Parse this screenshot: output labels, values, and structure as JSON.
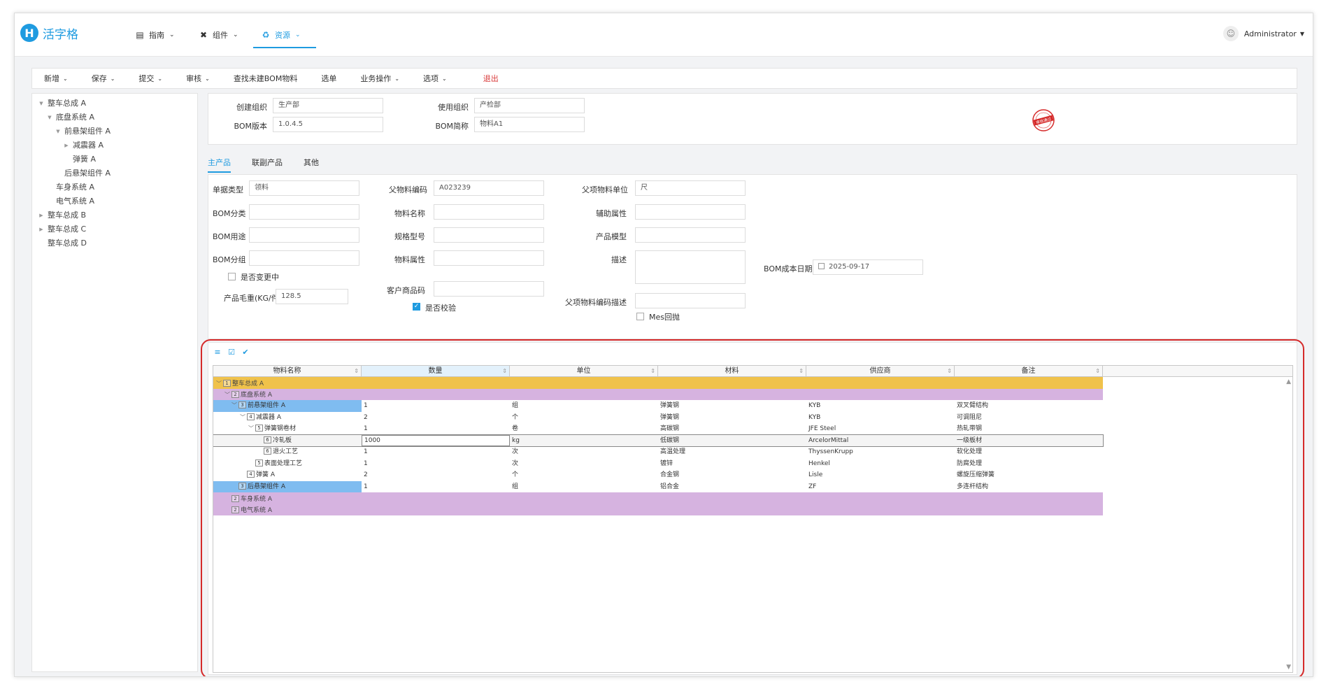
{
  "app": {
    "logo_letter": "H",
    "name": "活字格"
  },
  "nav": {
    "items": [
      {
        "label": "指南",
        "icon": "document-icon"
      },
      {
        "label": "组件",
        "icon": "tools-icon"
      },
      {
        "label": "资源",
        "icon": "recycle-icon"
      }
    ],
    "user": "Administrator"
  },
  "toolbar": {
    "items": [
      "新增",
      "保存",
      "提交",
      "审核",
      "查找未建BOM物料",
      "选单",
      "业务操作",
      "选项",
      "退出"
    ]
  },
  "tree": {
    "nodes": [
      {
        "label": "整车总成 A",
        "level": 0,
        "toggle": "▼"
      },
      {
        "label": "底盘系统 A",
        "level": 1,
        "toggle": "▼"
      },
      {
        "label": "前悬架组件 A",
        "level": 2,
        "toggle": "▼"
      },
      {
        "label": "减震器 A",
        "level": 3,
        "toggle": "▶"
      },
      {
        "label": "弹簧 A",
        "level": 3,
        "toggle": ""
      },
      {
        "label": "后悬架组件 A",
        "level": 2,
        "toggle": ""
      },
      {
        "label": "车身系统 A",
        "level": 1,
        "toggle": ""
      },
      {
        "label": "电气系统 A",
        "level": 1,
        "toggle": ""
      },
      {
        "label": "整车总成 B",
        "level": 0,
        "toggle": "▶"
      },
      {
        "label": "整车总成 C",
        "level": 0,
        "toggle": "▶"
      },
      {
        "label": "整车总成 D",
        "level": 0,
        "toggle": ""
      }
    ]
  },
  "header_form": {
    "create_org_label": "创建组织",
    "create_org": "生产部",
    "use_org_label": "使用组织",
    "use_org": "产检部",
    "bom_version_label": "BOM版本",
    "bom_version": "1.0.4.5",
    "bom_short_label": "BOM简称",
    "bom_short": "物料A1",
    "stamp_text": "审核通过",
    "stamp_color": "#d52a2a"
  },
  "tabs": [
    "主产品",
    "联副产品",
    "其他"
  ],
  "main_form": {
    "doc_type_label": "单据类型",
    "doc_type": "领料",
    "bom_category_label": "BOM分类",
    "bom_usage_label": "BOM用途",
    "bom_group_label": "BOM分组",
    "changing_label": "是否变更中",
    "gross_weight_label": "产品毛重(KG/件)",
    "gross_weight": "128.5",
    "parent_code_label": "父物料编码",
    "parent_code": "A023239",
    "material_name_label": "物料名称",
    "spec_label": "规格型号",
    "material_attr_label": "物料属性",
    "customer_code_label": "客户商品码",
    "verify_label": "是否校验",
    "parent_unit_label": "父项物料单位",
    "parent_unit": "尺",
    "aux_attr_label": "辅助属性",
    "product_model_label": "产品模型",
    "description_label": "描述",
    "parent_code_desc_label": "父项物料编码描述",
    "mes_label": "Mes回抛",
    "cost_date_label": "BOM成本日期",
    "cost_date": "2025-09-17"
  },
  "grid": {
    "columns": [
      "物料名称",
      "数量",
      "单位",
      "材料",
      "供应商",
      "备注"
    ],
    "group_colors": {
      "level1": "#f0c24b",
      "level2": "#d6b3e0",
      "selected": "#7fbcf0"
    },
    "rows": [
      {
        "level": "1",
        "toggle": "﹀",
        "name": "整车总成 A",
        "qty": "",
        "unit": "",
        "material": "",
        "supplier": "",
        "note": "",
        "style": "level1"
      },
      {
        "level": "2",
        "toggle": "﹀",
        "name": "底盘系统 A",
        "qty": "",
        "unit": "",
        "material": "",
        "supplier": "",
        "note": "",
        "style": "level2"
      },
      {
        "level": "3",
        "toggle": "﹀",
        "name": "前悬架组件 A",
        "qty": "1",
        "unit": "组",
        "material": "弹簧钢",
        "supplier": "KYB",
        "note": "双叉臂结构",
        "style": "selected"
      },
      {
        "level": "4",
        "toggle": "﹀",
        "name": "减震器 A",
        "qty": "2",
        "unit": "个",
        "material": "弹簧钢",
        "supplier": "KYB",
        "note": "可调阻尼",
        "style": "plain"
      },
      {
        "level": "5",
        "toggle": "﹀",
        "name": "弹簧钢卷材",
        "qty": "1",
        "unit": "卷",
        "material": "高碳钢",
        "supplier": "JFE Steel",
        "note": "热轧带钢",
        "style": "plain"
      },
      {
        "level": "6",
        "toggle": "",
        "name": "冷轧板",
        "qty": "1000",
        "unit": "kg",
        "material": "低碳钢",
        "supplier": "ArcelorMittal",
        "note": "一级板材",
        "style": "active"
      },
      {
        "level": "6",
        "toggle": "",
        "name": "退火工艺",
        "qty": "1",
        "unit": "次",
        "material": "高温处理",
        "supplier": "ThyssenKrupp",
        "note": "软化处理",
        "style": "plain"
      },
      {
        "level": "5",
        "toggle": "",
        "name": "表面处理工艺",
        "qty": "1",
        "unit": "次",
        "material": "镀锌",
        "supplier": "Henkel",
        "note": "防腐处理",
        "style": "plain"
      },
      {
        "level": "4",
        "toggle": "",
        "name": "弹簧 A",
        "qty": "2",
        "unit": "个",
        "material": "合金钢",
        "supplier": "Lisle",
        "note": "螺旋压缩弹簧",
        "style": "plain"
      },
      {
        "level": "3",
        "toggle": "",
        "name": "后悬架组件 A",
        "qty": "1",
        "unit": "组",
        "material": "铝合金",
        "supplier": "ZF",
        "note": "多连杆结构",
        "style": "selected"
      },
      {
        "level": "2",
        "toggle": "",
        "name": "车身系统 A",
        "qty": "",
        "unit": "",
        "material": "",
        "supplier": "",
        "note": "",
        "style": "level2"
      },
      {
        "level": "2",
        "toggle": "",
        "name": "电气系统 A",
        "qty": "",
        "unit": "",
        "material": "",
        "supplier": "",
        "note": "",
        "style": "level2"
      }
    ]
  }
}
